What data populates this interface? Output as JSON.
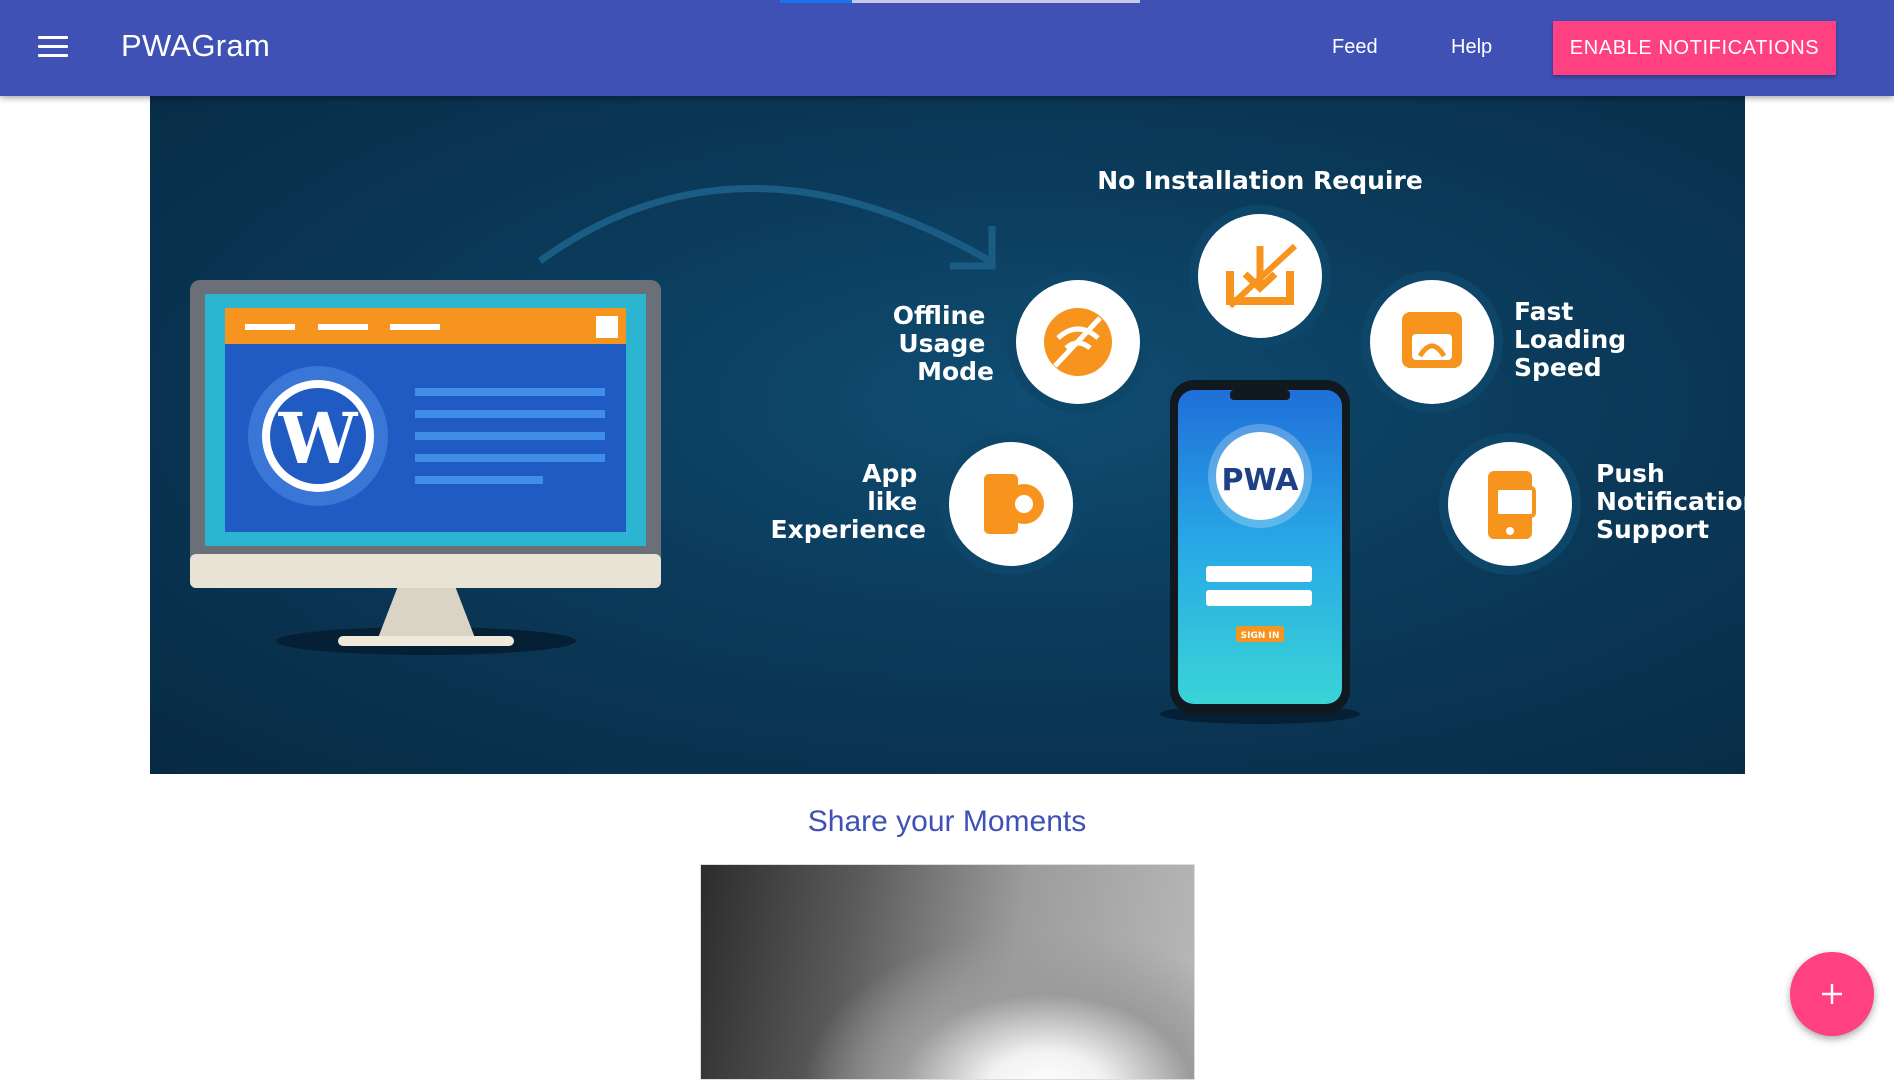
{
  "header": {
    "title": "PWAGram",
    "nav": {
      "feed": "Feed",
      "help": "Help"
    },
    "notify_button": "ENABLE NOTIFICATIONS",
    "loading_progress": 0.2
  },
  "hero": {
    "features": {
      "no_install": "No Installation Require",
      "offline": [
        "Offline",
        "Usage",
        "Mode"
      ],
      "fast": [
        "Fast",
        "Loading",
        "Speed"
      ],
      "app_like": [
        "App",
        "like",
        "Experience"
      ],
      "push": [
        "Push",
        "Notification",
        "Support"
      ]
    },
    "phone": {
      "logo": "PWA",
      "button": "SIGN IN"
    }
  },
  "section": {
    "title": "Share your Moments"
  },
  "colors": {
    "primary": "#3f51b5",
    "accent": "#ff4081",
    "orange": "#f7941d"
  }
}
